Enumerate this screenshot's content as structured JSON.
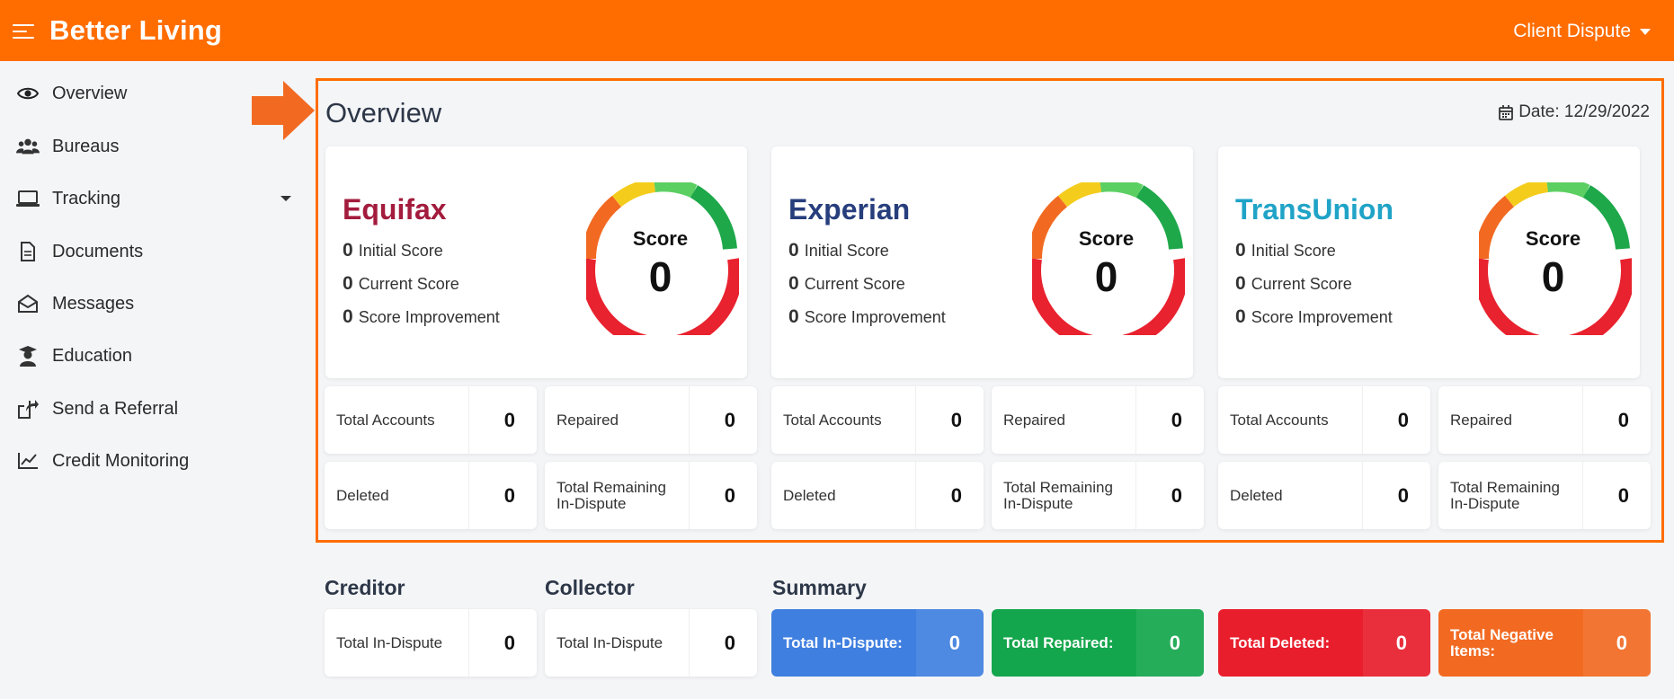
{
  "app": {
    "brand": "Better Living",
    "user_menu": "Client Dispute"
  },
  "sidebar": {
    "items": [
      {
        "label": "Overview",
        "icon": "eye-icon"
      },
      {
        "label": "Bureaus",
        "icon": "users-icon"
      },
      {
        "label": "Tracking",
        "icon": "laptop-icon"
      },
      {
        "label": "Documents",
        "icon": "document-icon"
      },
      {
        "label": "Messages",
        "icon": "envelope-open-icon"
      },
      {
        "label": "Education",
        "icon": "graduate-icon"
      },
      {
        "label": "Send a Referral",
        "icon": "share-icon"
      },
      {
        "label": "Credit Monitoring",
        "icon": "chart-line-icon"
      }
    ]
  },
  "overview": {
    "title": "Overview",
    "date": "Date: 12/29/2022"
  },
  "bureaus": [
    {
      "name": "Equifax",
      "color": "#a31c3d",
      "initial_score": "0",
      "initial_label": "Initial Score",
      "current_score": "0",
      "current_label": "Current Score",
      "improvement": "0",
      "improvement_label": "Score Improvement",
      "score_label": "Score",
      "score_value": "0",
      "total_accounts_label": "Total Accounts",
      "total_accounts": "0",
      "repaired_label": "Repaired",
      "repaired": "0",
      "deleted_label": "Deleted",
      "deleted": "0",
      "remaining_label": "Total Remaining In-Dispute",
      "remaining": "0"
    },
    {
      "name": "Experian",
      "color": "#273e7d",
      "initial_score": "0",
      "initial_label": "Initial Score",
      "current_score": "0",
      "current_label": "Current Score",
      "improvement": "0",
      "improvement_label": "Score Improvement",
      "score_label": "Score",
      "score_value": "0",
      "total_accounts_label": "Total Accounts",
      "total_accounts": "0",
      "repaired_label": "Repaired",
      "repaired": "0",
      "deleted_label": "Deleted",
      "deleted": "0",
      "remaining_label": "Total Remaining In-Dispute",
      "remaining": "0"
    },
    {
      "name": "TransUnion",
      "color": "#1fa3c7",
      "initial_score": "0",
      "initial_label": "Initial Score",
      "current_score": "0",
      "current_label": "Current Score",
      "improvement": "0",
      "improvement_label": "Score Improvement",
      "score_label": "Score",
      "score_value": "0",
      "total_accounts_label": "Total Accounts",
      "total_accounts": "0",
      "repaired_label": "Repaired",
      "repaired": "0",
      "deleted_label": "Deleted",
      "deleted": "0",
      "remaining_label": "Total Remaining In-Dispute",
      "remaining": "0"
    }
  ],
  "creditor": {
    "title": "Creditor",
    "label": "Total In-Dispute",
    "value": "0"
  },
  "collector": {
    "title": "Collector",
    "label": "Total In-Dispute",
    "value": "0"
  },
  "summary": {
    "title": "Summary",
    "cards": [
      {
        "label": "Total In-Dispute:",
        "value": "0",
        "color": "#3f7fe0"
      },
      {
        "label": "Total Repaired:",
        "value": "0",
        "color": "#14a64c"
      },
      {
        "label": "Total Deleted:",
        "value": "0",
        "color": "#e91e2c"
      },
      {
        "label": "Total Negative Items:",
        "value": "0",
        "color": "#f26a22"
      }
    ]
  },
  "colors": {
    "accent": "#ff6d00",
    "gauge_red": "#e8222e",
    "gauge_orange": "#f26a22",
    "gauge_yellow": "#f4cc1c",
    "gauge_light_green": "#5ccf62",
    "gauge_green": "#1ea84a"
  }
}
